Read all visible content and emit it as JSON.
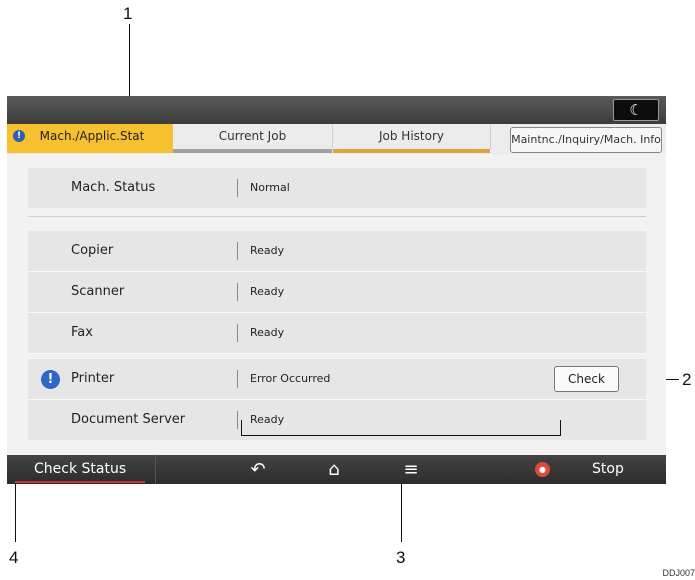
{
  "callouts": {
    "c1": "1",
    "c2": "2",
    "c3": "3",
    "c4": "4"
  },
  "doc_id": "DDJ007",
  "topbar": {
    "mode_icon": "moon-icon",
    "mode_glyph": "☾"
  },
  "tabs": [
    {
      "label": "Mach./Applic.Stat",
      "active": true,
      "alert": "!"
    },
    {
      "label": "Current Job",
      "active": false
    },
    {
      "label": "Job History",
      "active": false
    }
  ],
  "maint_button": "Maintnc./Inquiry/Mach. Info",
  "mach_status": {
    "label": "Mach. Status",
    "value": "Normal"
  },
  "functions": [
    {
      "label": "Copier",
      "value": "Ready"
    },
    {
      "label": "Scanner",
      "value": "Ready"
    },
    {
      "label": "Fax",
      "value": "Ready"
    },
    {
      "label": "Printer",
      "value": "Error Occurred",
      "warning": "!",
      "action": "Check"
    },
    {
      "label": "Document Server",
      "value": "Ready"
    }
  ],
  "bottom_bar": {
    "check_status": "Check Status",
    "back_icon": "back-arrow-icon",
    "home_icon": "home-icon",
    "menu_icon": "menu-icon",
    "stop_icon": "stop-icon",
    "stop_label": "Stop"
  },
  "colors": {
    "active_tab": "#f7c02e",
    "alert_blue": "#3066c4",
    "stop_red": "#e0483a",
    "check_status_underline": "#d0332d"
  }
}
